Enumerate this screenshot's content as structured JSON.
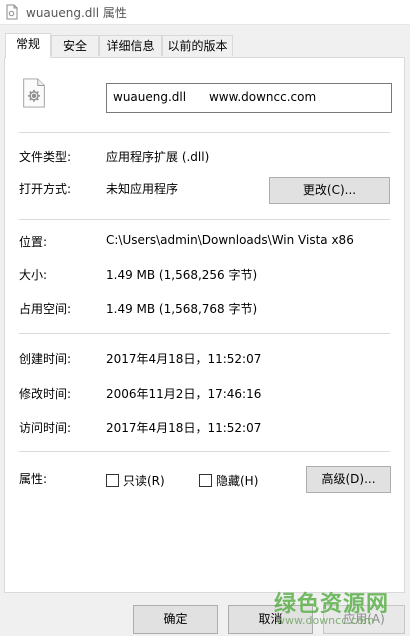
{
  "window": {
    "title": "wuaueng.dll 属性",
    "icon": "dll-file-icon"
  },
  "tabs": [
    {
      "label": "常规",
      "active": true
    },
    {
      "label": "安全",
      "active": false
    },
    {
      "label": "详细信息",
      "active": false
    },
    {
      "label": "以前的版本",
      "active": false
    }
  ],
  "general": {
    "file_icon": "gear-file-icon",
    "file_name": "wuaueng.dll      www.downcc.com",
    "file_type_label": "文件类型:",
    "file_type_value": "应用程序扩展 (.dll)",
    "open_with_label": "打开方式:",
    "open_with_value": "未知应用程序",
    "change_button": "更改(C)...",
    "location_label": "位置:",
    "location_value": "C:\\Users\\admin\\Downloads\\Win Vista x86",
    "size_label": "大小:",
    "size_value": "1.49 MB (1,568,256 字节)",
    "size_on_disk_label": "占用空间:",
    "size_on_disk_value": "1.49 MB (1,568,768 字节)",
    "created_label": "创建时间:",
    "created_value": "2017年4月18日，11:52:07",
    "modified_label": "修改时间:",
    "modified_value": "2006年11月2日，17:46:16",
    "accessed_label": "访问时间:",
    "accessed_value": "2017年4月18日，11:52:07",
    "attributes_label": "属性:",
    "readonly_label": "只读(R)",
    "readonly_checked": false,
    "hidden_label": "隐藏(H)",
    "hidden_checked": false,
    "advanced_button": "高级(D)..."
  },
  "footer": {
    "ok_button": "确定",
    "cancel_button": "取消",
    "apply_button": "应用(A)"
  },
  "watermark": {
    "main": "绿色资源网",
    "sub": "www.downcc.com"
  }
}
